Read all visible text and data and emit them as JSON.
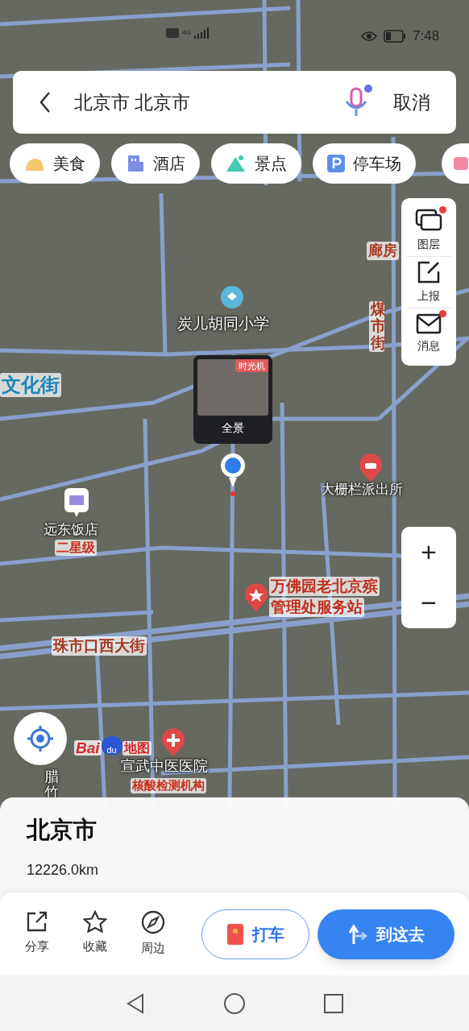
{
  "status_bar": {
    "network": "4G",
    "time": "7:48"
  },
  "search": {
    "value": "北京市 北京市",
    "cancel": "取消"
  },
  "category_chips": [
    {
      "label": "美食",
      "kind": "food"
    },
    {
      "label": "酒店",
      "kind": "hotel"
    },
    {
      "label": "景点",
      "kind": "scenic"
    },
    {
      "label": "停车场",
      "kind": "parking"
    }
  ],
  "map_tools": [
    {
      "label": "图层",
      "kind": "layers",
      "badge": true
    },
    {
      "label": "上报",
      "kind": "report",
      "badge": false
    },
    {
      "label": "消息",
      "kind": "message",
      "badge": true
    }
  ],
  "map_labels": [
    {
      "text": "廊房",
      "kind": "road",
      "vertical": false
    },
    {
      "text": "炭儿胡同小学",
      "kind": "place",
      "vertical": false
    },
    {
      "text": "煤市街",
      "kind": "road",
      "vertical": true
    },
    {
      "text": "文化街",
      "kind": "street",
      "vertical": false
    },
    {
      "text": "大栅栏派出所",
      "kind": "place",
      "vertical": false
    },
    {
      "text": "远东饭店",
      "kind": "place",
      "vertical": false
    },
    {
      "text": "二星级",
      "kind": "tag",
      "vertical": false
    },
    {
      "text": "万佛园老北京殡",
      "kind": "red_poi",
      "vertical": false
    },
    {
      "text": "管理处服务站",
      "kind": "red_poi",
      "vertical": false
    },
    {
      "text": "珠市口西大街",
      "kind": "road",
      "vertical": false
    },
    {
      "text": "腊竹",
      "kind": "place",
      "vertical": true
    },
    {
      "text": "宣武中医医院",
      "kind": "place",
      "vertical": false
    },
    {
      "text": "核酸检测机构",
      "kind": "tag",
      "vertical": false
    }
  ],
  "panorama": {
    "badge": "时光机",
    "label": "全景"
  },
  "map_logo": {
    "brand": "Bai",
    "paw": "du",
    "suffix": "地图"
  },
  "zoom": {
    "plus": "+",
    "minus": "−"
  },
  "place": {
    "name": "北京市",
    "distance": "12226.0km"
  },
  "actions": [
    {
      "label": "分享",
      "kind": "share"
    },
    {
      "label": "收藏",
      "kind": "star"
    },
    {
      "label": "周边",
      "kind": "compass"
    }
  ],
  "taxi_button": "打车",
  "go_button": "到这去"
}
